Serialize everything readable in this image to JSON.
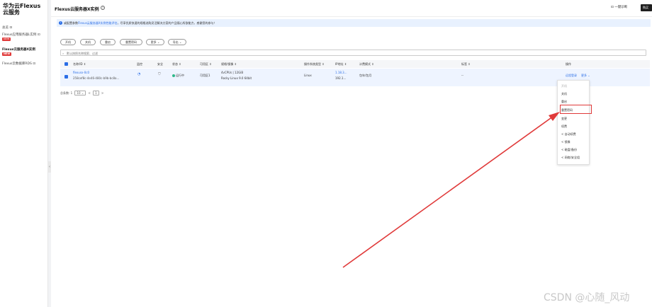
{
  "sidebar": {
    "brand": "华为云Flexus云服务",
    "items": [
      {
        "label": "总览 ⊡"
      },
      {
        "label": "Flexus应用服务器L实例 ⊡",
        "badge": "NEW"
      },
      {
        "label": "Flexus云服务器X实例",
        "badge": "NEW"
      },
      {
        "label": "Flexus云数据库RDS ⊡"
      }
    ]
  },
  "header": {
    "title": "Flexus云服务器X实例",
    "quick_label": "⊡ 一键诊断",
    "dark_button": "购买"
  },
  "notice": {
    "prefix": "或配置参数",
    "link": "Flexus云服务器X实例性能评估",
    "suffix": "，尽享优质快速的规格选购灵活解决方案的产品随心所欲能力，感谢您的参与！"
  },
  "toolbar": {
    "buttons": [
      "开机",
      "关机",
      "重启",
      "重置密码",
      "更多 ⌄",
      "导出 ⌄"
    ]
  },
  "search": {
    "placeholder": "默认按照名称搜索、过滤"
  },
  "table": {
    "columns": [
      "名称/ID ⇕",
      "监控",
      "安全",
      "状态 ⇕",
      "可用区 ⇕",
      "规格/镜像 ⇕",
      "操作系统类型 ⇕",
      "IP地址 ⇕",
      "计费模式 ⇕",
      "标签 ⇕",
      "操作"
    ],
    "row": {
      "name": "flexusx-0c0",
      "id": "258cef8c-4e46-480c-b9b-bc8a...",
      "status": "运行中",
      "zone": "可用区1",
      "spec_line1": "4vCPUs | 12GiB",
      "spec_line2": "Rocky Linux 9.0 64bit",
      "os": "Linux",
      "ip_line1": "1.18.3...",
      "ip_line2": "192.1...",
      "billing": "包年/包月",
      "tags": "--",
      "op_remote": "远程登录",
      "op_more": "更多 ⌄"
    }
  },
  "pager": {
    "total_label": "总条数: 1",
    "page_size": "10 ⌄",
    "prev": "<",
    "page": "1",
    "next": ">"
  },
  "menu": {
    "items": [
      {
        "label": "开机",
        "disabled": true
      },
      {
        "label": "关机"
      },
      {
        "label": "重启"
      },
      {
        "label": "重置密码"
      },
      {
        "label": "变更"
      },
      {
        "label": "续费"
      },
      {
        "label": "< 自动续费"
      },
      {
        "label": "< 镜像"
      },
      {
        "label": "< 磁盘/备份"
      },
      {
        "label": "< 网络/安全组"
      }
    ]
  },
  "colors": {
    "accent": "#2b6ee6",
    "highlight": "#e03a3a",
    "status_ok": "#2eb88a"
  },
  "watermark": "CSDN @心随_风动"
}
